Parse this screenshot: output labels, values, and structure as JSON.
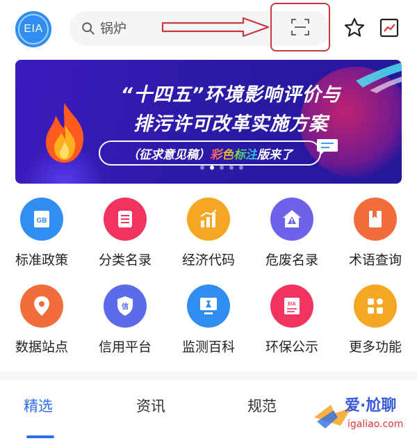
{
  "header": {
    "logo_text": "EIA",
    "search_placeholder": "锅炉"
  },
  "banner": {
    "line1": "“十四五”环境影响评价与",
    "line2": "排污许可改革实施方案",
    "pill_open": "（",
    "pill_part1": "征求意见稿",
    "pill_close": "）",
    "pill_part2": "彩色标注",
    "pill_part3": "版来了",
    "slide_count": 5,
    "active_slide": 2
  },
  "grid": {
    "items": [
      {
        "label": "标准政策",
        "icon": "gb-standard-icon",
        "color": "#2f8ef0"
      },
      {
        "label": "分类名录",
        "icon": "list-icon",
        "color": "#f0335f"
      },
      {
        "label": "经济代码",
        "icon": "bar-chart-icon",
        "color": "#f5a623"
      },
      {
        "label": "危废名录",
        "icon": "hazard-house-icon",
        "color": "#6c63e8"
      },
      {
        "label": "术语查询",
        "icon": "book-icon",
        "color": "#f36d3a"
      },
      {
        "label": "数据站点",
        "icon": "location-pin-icon",
        "color": "#f36d3a"
      },
      {
        "label": "信用平台",
        "icon": "credit-shield-icon",
        "color": "#5b6ce8"
      },
      {
        "label": "监测百科",
        "icon": "monitor-icon",
        "color": "#2f8ef0"
      },
      {
        "label": "环保公示",
        "icon": "eia-notice-icon",
        "color": "#f0335f"
      },
      {
        "label": "更多功能",
        "icon": "more-grid-icon",
        "color": "#f5a623"
      }
    ]
  },
  "tabs": {
    "items": [
      "精选",
      "资讯",
      "规范"
    ],
    "active": 0
  },
  "watermark": {
    "line1": "爱·尬聊",
    "line2": "igaliao.com"
  },
  "colors": {
    "accent": "#2f6ee8",
    "annotation_red": "#c9383d"
  }
}
